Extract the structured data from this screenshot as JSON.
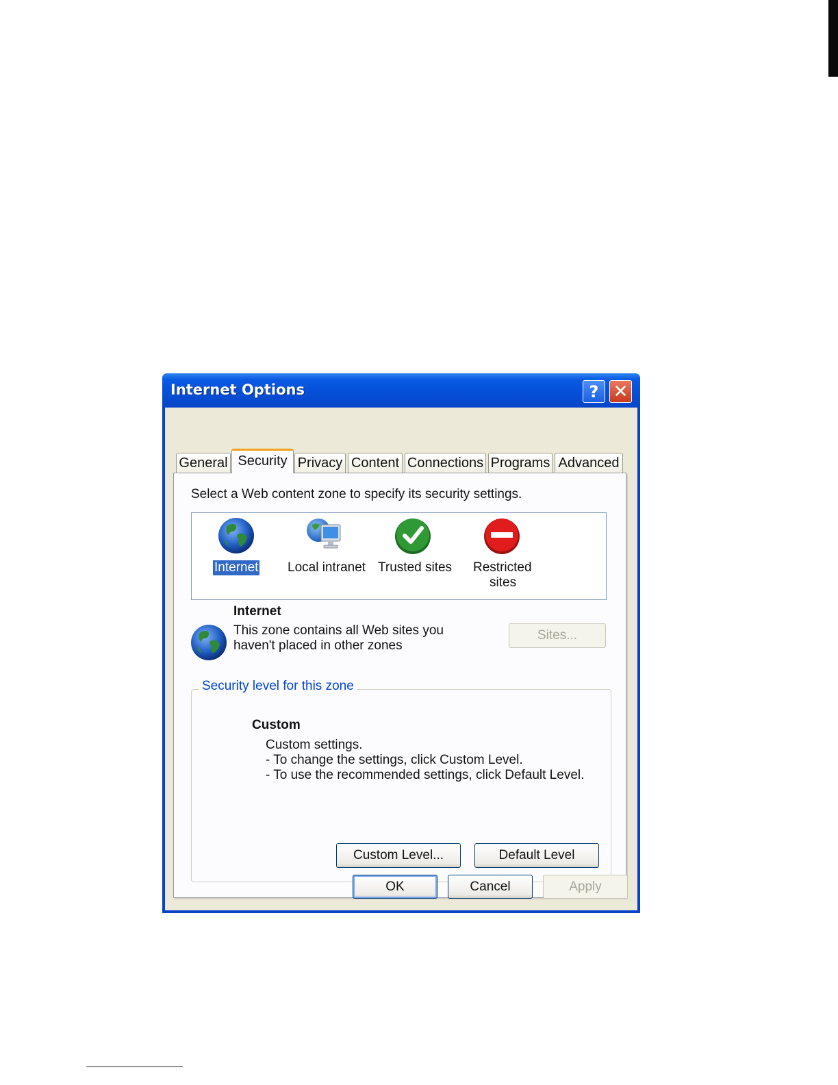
{
  "window": {
    "title": "Internet Options",
    "help_button": "?",
    "close_button": "✕"
  },
  "tabs": [
    {
      "label": "General"
    },
    {
      "label": "Security"
    },
    {
      "label": "Privacy"
    },
    {
      "label": "Content"
    },
    {
      "label": "Connections"
    },
    {
      "label": "Programs"
    },
    {
      "label": "Advanced"
    }
  ],
  "active_tab": "Security",
  "security": {
    "instruction": "Select a Web content zone to specify its security settings.",
    "zones": [
      {
        "label": "Internet",
        "icon": "globe-icon",
        "selected": true
      },
      {
        "label": "Local intranet",
        "icon": "intranet-icon",
        "selected": false
      },
      {
        "label": "Trusted sites",
        "icon": "checkmark-icon",
        "selected": false
      },
      {
        "label_line1": "Restricted",
        "label_line2": "sites",
        "icon": "no-entry-icon",
        "selected": false
      }
    ],
    "zone_info": {
      "title": "Internet",
      "line1": "This zone contains all Web sites you",
      "line2": "haven't placed in other zones",
      "sites_button": "Sites..."
    },
    "level": {
      "group_title": "Security level for this zone",
      "name": "Custom",
      "line1": "Custom settings.",
      "line2": "- To change the settings, click Custom Level.",
      "line3": "- To use the recommended settings, click Default Level.",
      "custom_button": "Custom Level...",
      "default_button": "Default Level"
    }
  },
  "footer": {
    "ok": "OK",
    "cancel": "Cancel",
    "apply": "Apply"
  },
  "colors": {
    "titlebar": "#0550d8",
    "selection": "#316ac5",
    "group_title": "#0046d5",
    "active_tab_accent": "#f7a21c"
  }
}
